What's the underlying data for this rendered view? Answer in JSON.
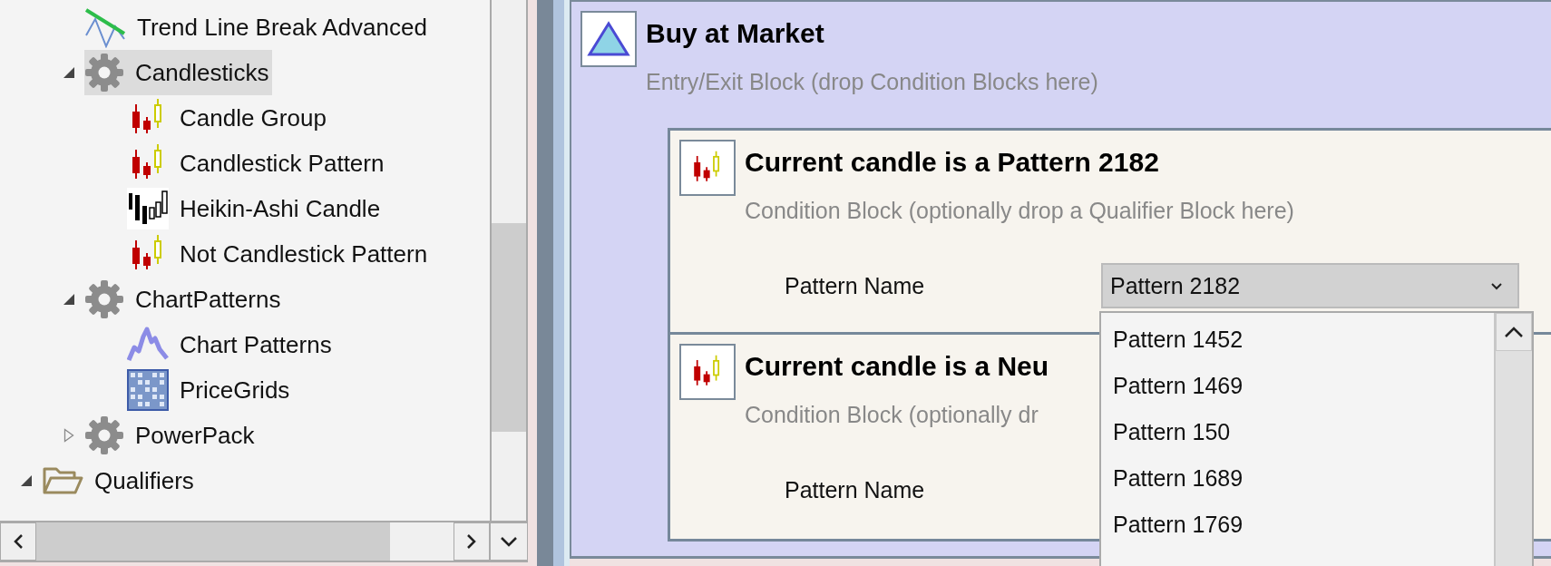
{
  "tree": [
    {
      "children": [
        {
          "label": "Trend Line Break Advanced",
          "kind": "trendline",
          "selected": false
        },
        {
          "label": "Candlesticks",
          "kind": "gear",
          "selected": true,
          "expanded": true,
          "children": [
            {
              "label": "Candle Group",
              "kind": "candles",
              "selected": false
            },
            {
              "label": "Candlestick Pattern",
              "kind": "candles",
              "selected": false
            },
            {
              "label": "Heikin-Ashi Candle",
              "kind": "heikin",
              "selected": false
            },
            {
              "label": "Not Candlestick Pattern",
              "kind": "candles",
              "selected": false
            }
          ]
        },
        {
          "label": "ChartPatterns",
          "kind": "gear",
          "selected": false,
          "expanded": true,
          "children": [
            {
              "label": "Chart Patterns",
              "kind": "chartpattern",
              "selected": false
            },
            {
              "label": "PriceGrids",
              "kind": "pricegrid",
              "selected": false
            }
          ]
        },
        {
          "label": "PowerPack",
          "kind": "gear",
          "selected": false,
          "expanded": false
        }
      ]
    },
    {
      "label": "Qualifiers",
      "kind": "folder",
      "selected": false,
      "expanded": true
    }
  ],
  "entry_block": {
    "title": "Buy at Market",
    "subtitle": "Entry/Exit Block (drop Condition Blocks here)",
    "condition_blocks": [
      {
        "title": "Current candle is a Pattern 2182",
        "subtitle": "Condition Block (optionally drop a Qualifier Block here)",
        "field_label": "Pattern Name",
        "field_value": "Pattern 2182"
      },
      {
        "title": "Current candle is a Neu",
        "subtitle": "Condition Block (optionally dr",
        "field_label": "Pattern Name"
      }
    ]
  },
  "dropdown_list": {
    "options": [
      {
        "label": "Pattern 1452",
        "selected": false
      },
      {
        "label": "Pattern 1469",
        "selected": false
      },
      {
        "label": "Pattern 150",
        "selected": false
      },
      {
        "label": "Pattern 1689",
        "selected": false
      },
      {
        "label": "Pattern 1769",
        "selected": false
      }
    ]
  }
}
